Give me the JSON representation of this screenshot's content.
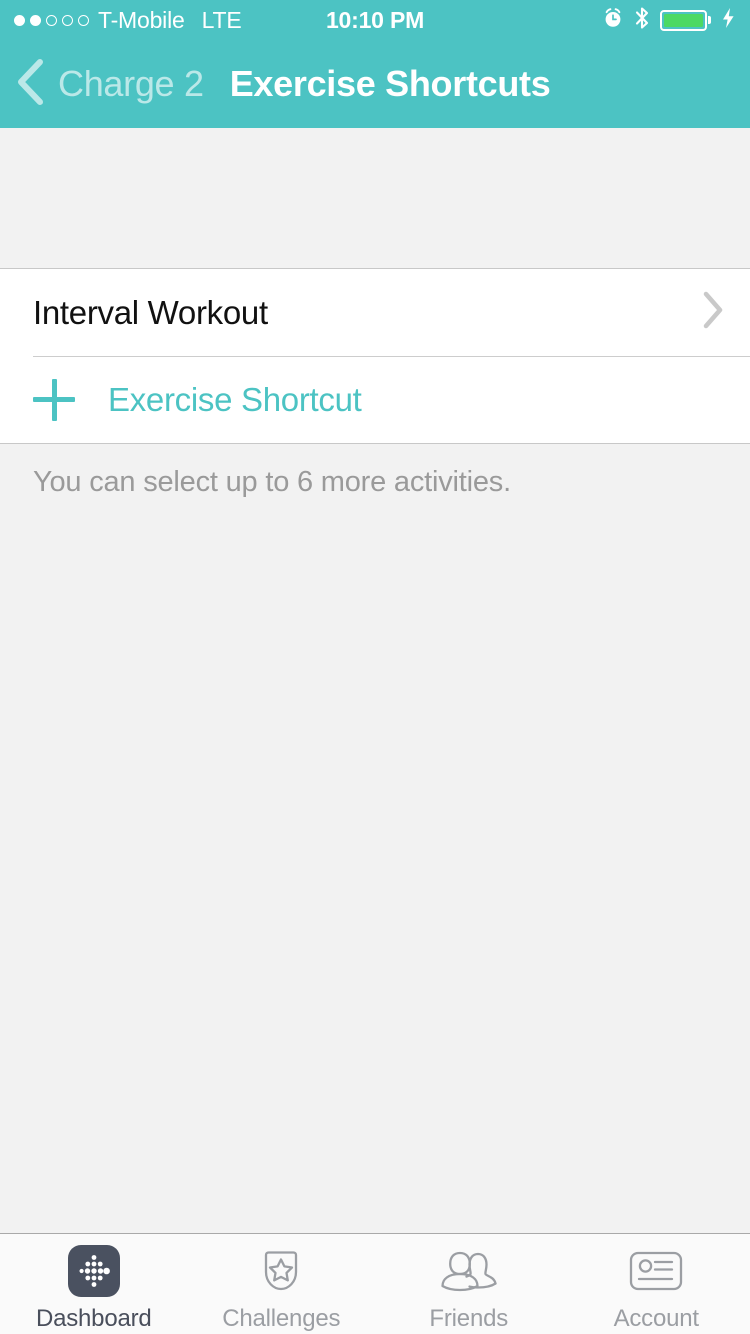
{
  "status_bar": {
    "signal_dots_filled": 2,
    "signal_dots_total": 5,
    "carrier": "T-Mobile",
    "network_type": "LTE",
    "time": "10:10 PM",
    "icons": [
      "alarm-clock-icon",
      "bluetooth-icon",
      "battery-icon",
      "charging-bolt-icon"
    ],
    "battery_level_percent": 92,
    "battery_color": "#4cd964"
  },
  "nav_bar": {
    "back_label": "Charge 2",
    "back_icon": "chevron-left-icon",
    "title": "Exercise Shortcuts",
    "background_color": "#4cc3c3"
  },
  "list": {
    "rows": [
      {
        "label": "Interval Workout",
        "accessory_icon": "chevron-right-icon"
      }
    ],
    "add_row": {
      "icon": "plus-icon",
      "label": "Exercise Shortcut",
      "accent_color": "#4cc3c3"
    }
  },
  "footnote": "You can select up to 6 more activities.",
  "tab_bar": {
    "tabs": [
      {
        "label": "Dashboard",
        "icon": "fitbit-dots-logo-icon",
        "active": true
      },
      {
        "label": "Challenges",
        "icon": "shield-star-icon",
        "active": false
      },
      {
        "label": "Friends",
        "icon": "two-people-icon",
        "active": false
      },
      {
        "label": "Account",
        "icon": "id-card-icon",
        "active": false
      }
    ],
    "active_color": "#4a4f5c",
    "inactive_color": "#9b9ea3"
  }
}
